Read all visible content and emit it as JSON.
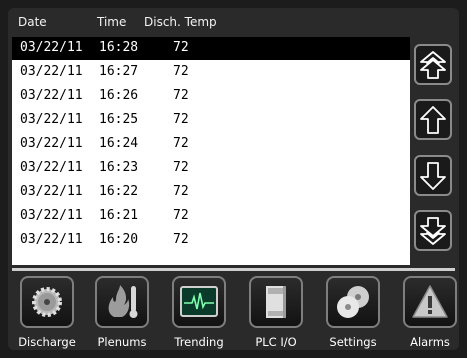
{
  "header": {
    "date": "Date",
    "time": "Time",
    "temp": "Disch. Temp"
  },
  "rows": [
    {
      "date": "03/22/11",
      "time": "16:28",
      "temp": "72"
    },
    {
      "date": "03/22/11",
      "time": "16:27",
      "temp": "72"
    },
    {
      "date": "03/22/11",
      "time": "16:26",
      "temp": "72"
    },
    {
      "date": "03/22/11",
      "time": "16:25",
      "temp": "72"
    },
    {
      "date": "03/22/11",
      "time": "16:24",
      "temp": "72"
    },
    {
      "date": "03/22/11",
      "time": "16:23",
      "temp": "72"
    },
    {
      "date": "03/22/11",
      "time": "16:22",
      "temp": "72"
    },
    {
      "date": "03/22/11",
      "time": "16:21",
      "temp": "72"
    },
    {
      "date": "03/22/11",
      "time": "16:20",
      "temp": "72"
    }
  ],
  "scroll_buttons": [
    "page-up-icon",
    "arrow-up-icon",
    "arrow-down-icon",
    "page-down-icon"
  ],
  "nav": {
    "discharge": "Discharge",
    "plenums": "Plenums",
    "trending": "Trending",
    "plc_io": "PLC I/O",
    "settings": "Settings",
    "alarms": "Alarms"
  },
  "colors": {
    "selected_row": "#000000",
    "list_bg": "#ffffff",
    "panel_bg": "#2a2a2a"
  }
}
